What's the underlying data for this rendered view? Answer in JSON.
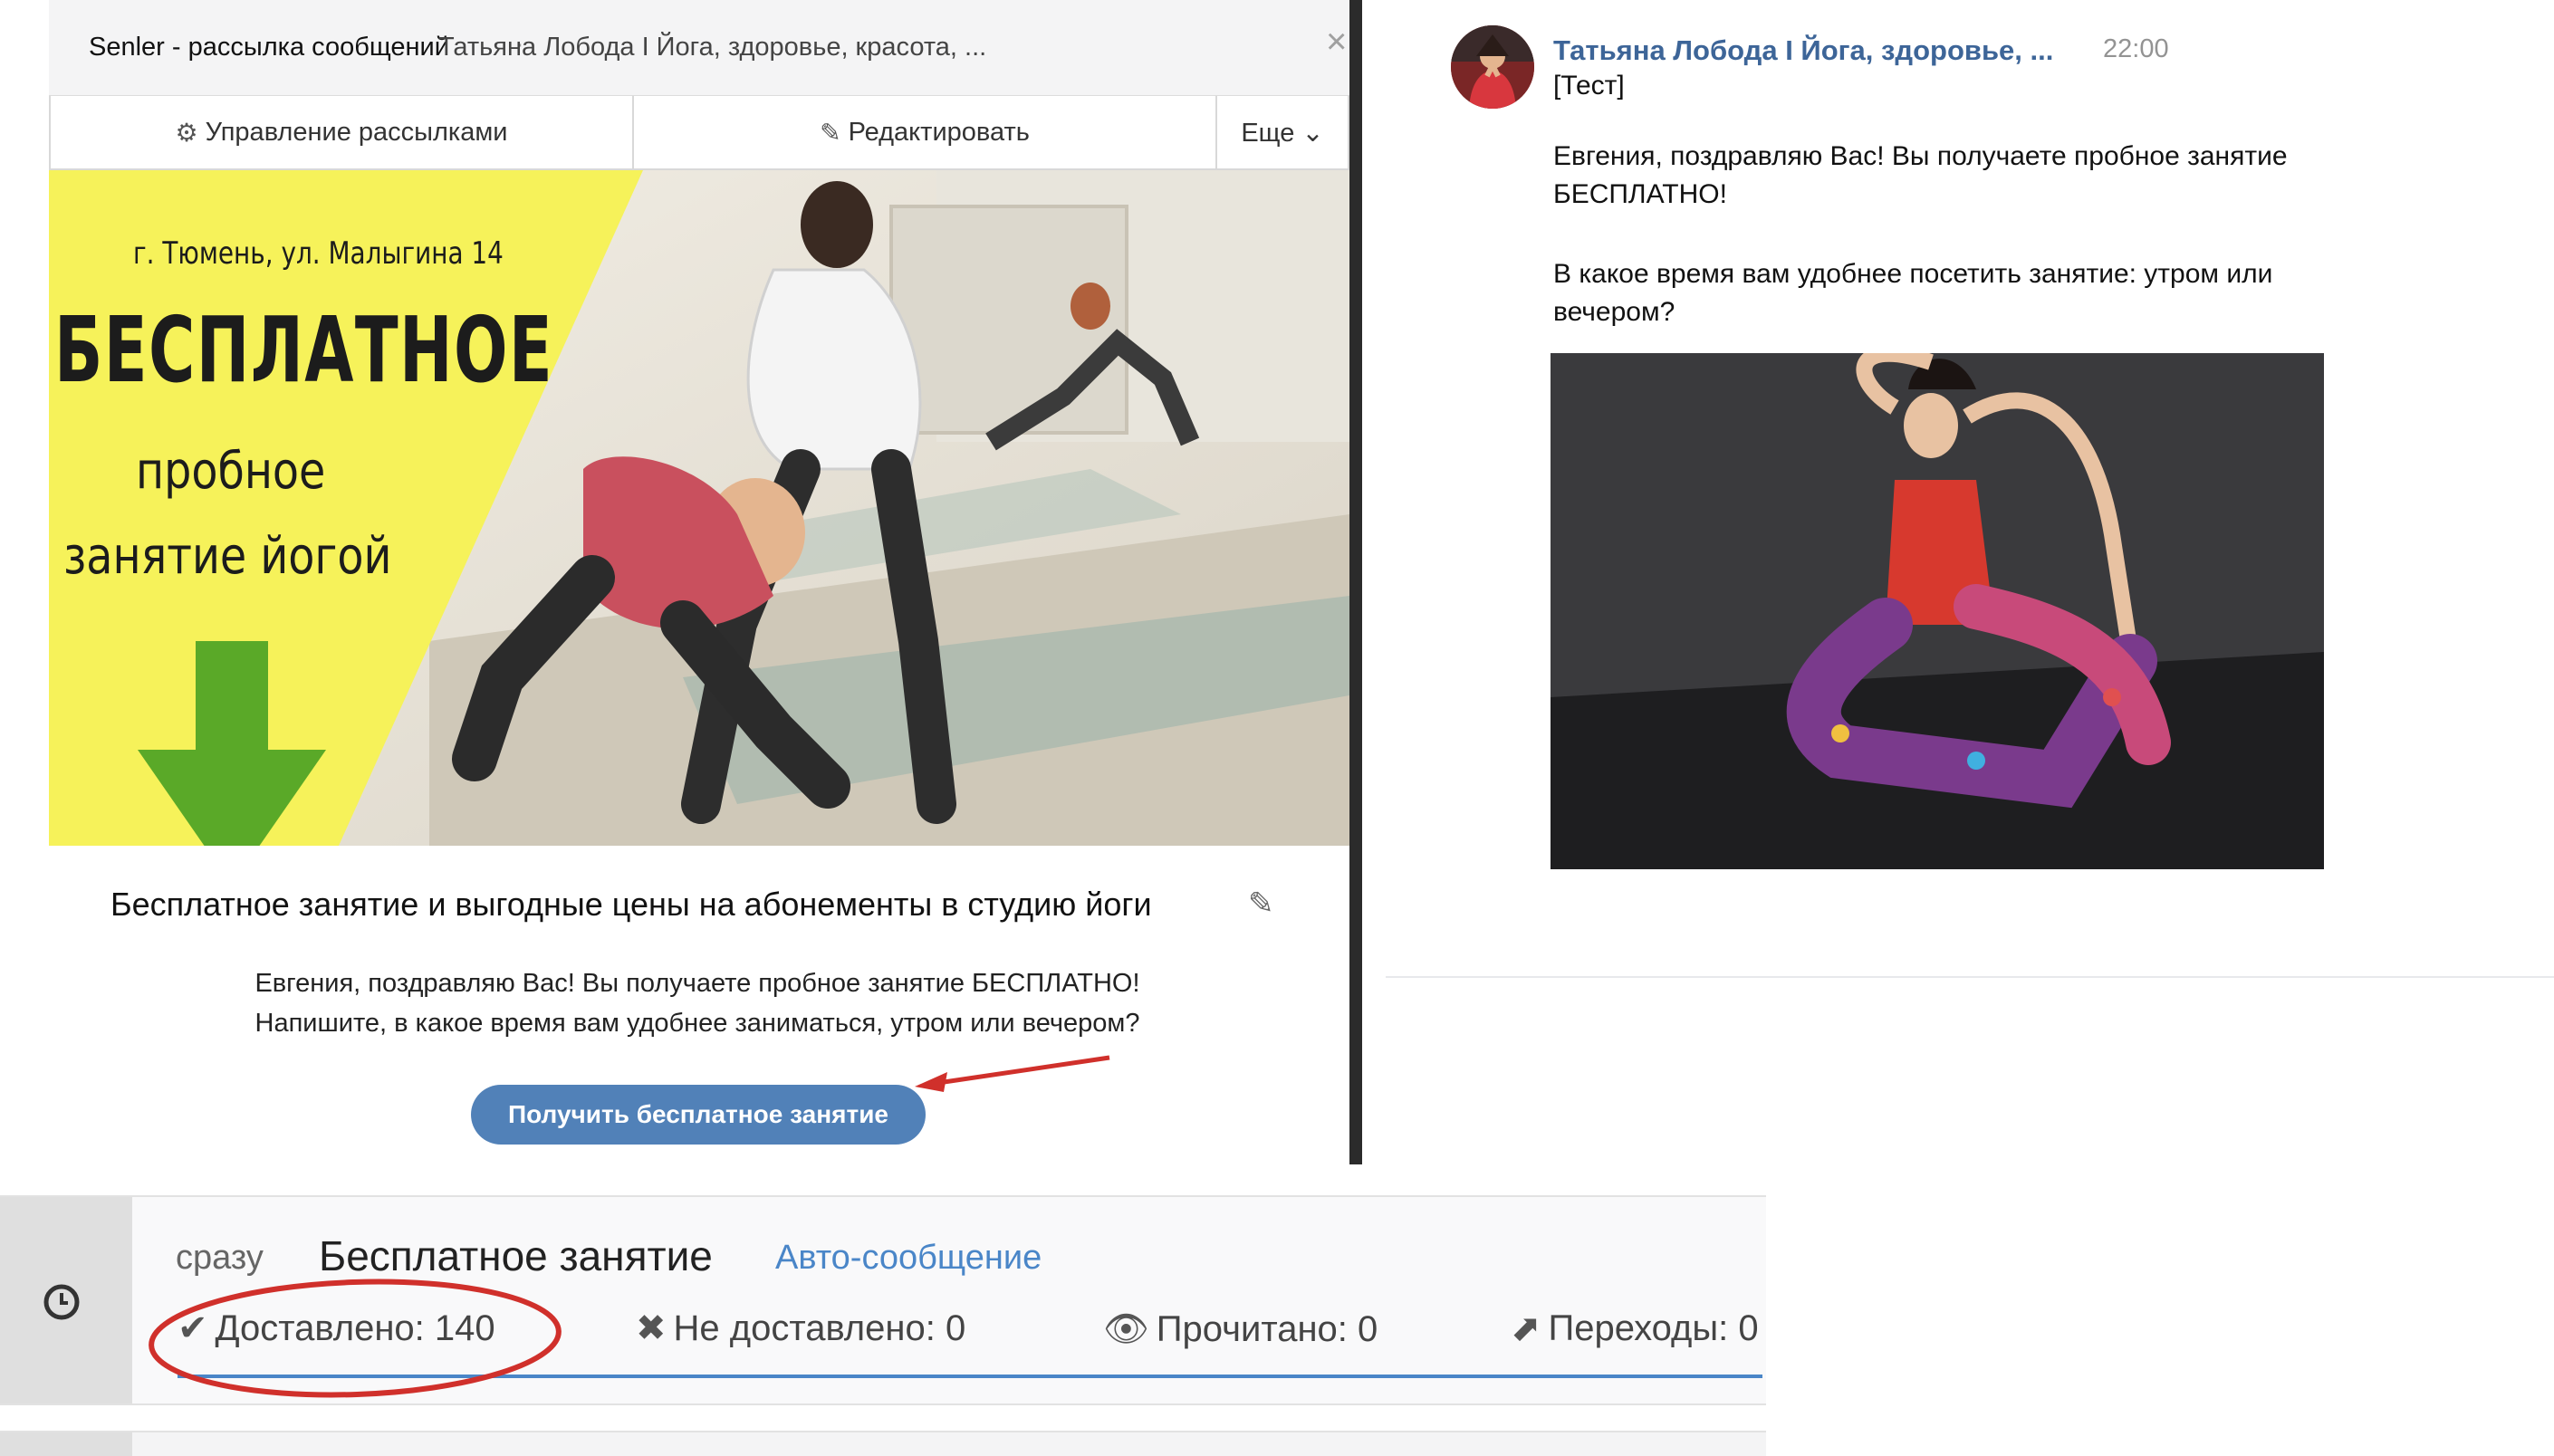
{
  "panel": {
    "title": "Senler - рассылка сообщений",
    "separator": "·",
    "subtitle": "Татьяна Лобода I Йога, здоровье, красота, ...",
    "close_glyph": "×"
  },
  "toolbar": {
    "manage_label": "Управление рассылками",
    "edit_label": "Редактировать",
    "more_label": "Еще ⌄"
  },
  "banner": {
    "address": "г. Тюмень, ул. Малыгина 14",
    "free": "БЕСПЛАТНОЕ",
    "trial": "пробное",
    "yoga": "занятие йогой",
    "yellow": "#f6f25a",
    "arrow_green": "#5aa928"
  },
  "card": {
    "title": "Бесплатное занятие и выгодные цены на абонементы в студию йоги",
    "text_line1": "Евгения, поздравляю Вас! Вы получаете пробное занятие БЕСПЛАТНО!",
    "text_line2": "Напишите, в какое время вам удобнее заниматься, утром или вечером?",
    "cta_label": "Получить бесплатное занятие",
    "cta_color": "#5181b8"
  },
  "message": {
    "sender": "Татьяна Лобода I Йога, здоровье, ...",
    "time": "22:00",
    "tag": "[Тест]",
    "line1": "Евгения, поздравляю Вас! Вы получаете пробное занятие",
    "line2": "БЕСПЛАТНО!",
    "line3": "В какое время вам удобнее посетить занятие: утром или",
    "line4": "вечером?",
    "link_color": "#3d6598"
  },
  "stats": {
    "timing": "сразу",
    "name": "Бесплатное занятие",
    "type": "Авто-сообщение",
    "delivered": "Доставлено: 140",
    "not_delivered": "Не доставлено: 0",
    "read": "Прочитано: 0",
    "clicks": "Переходы: 0",
    "accent": "#4a86c8",
    "annotation_color": "#d0302b"
  }
}
